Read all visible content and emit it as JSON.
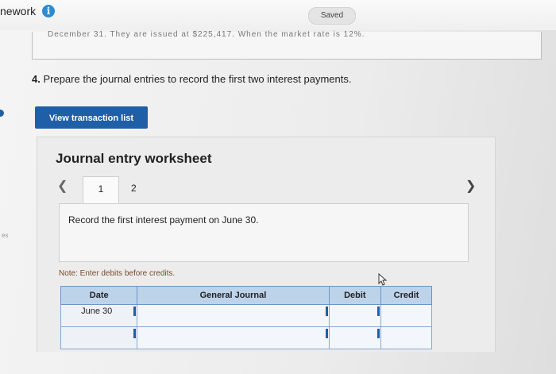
{
  "header": {
    "app_title": "nework",
    "info_icon": "info-icon",
    "saved_label": "Saved"
  },
  "previous_text": "December 31. They are issued at $225,417. When the market rate is 12%.",
  "question": {
    "number": "4.",
    "text": "Prepare the journal entries to record the first two interest payments."
  },
  "view_button_label": "View transaction list",
  "worksheet": {
    "title": "Journal entry worksheet",
    "prev_icon": "chevron-left-icon",
    "next_icon": "chevron-right-icon",
    "pages": [
      "1",
      "2"
    ],
    "active_page": "1",
    "instruction": "Record the first interest payment on June 30.",
    "note": "Note: Enter debits before credits.",
    "table": {
      "headers": [
        "Date",
        "General Journal",
        "Debit",
        "Credit"
      ],
      "rows": [
        {
          "date": "June 30",
          "account": "",
          "debit": "",
          "credit": ""
        },
        {
          "date": "",
          "account": "",
          "debit": "",
          "credit": ""
        }
      ]
    }
  },
  "side_mark": "es",
  "colors": {
    "accent": "#1f5fa8",
    "info": "#2e8bcf",
    "table_header": "#bcd3ea"
  }
}
